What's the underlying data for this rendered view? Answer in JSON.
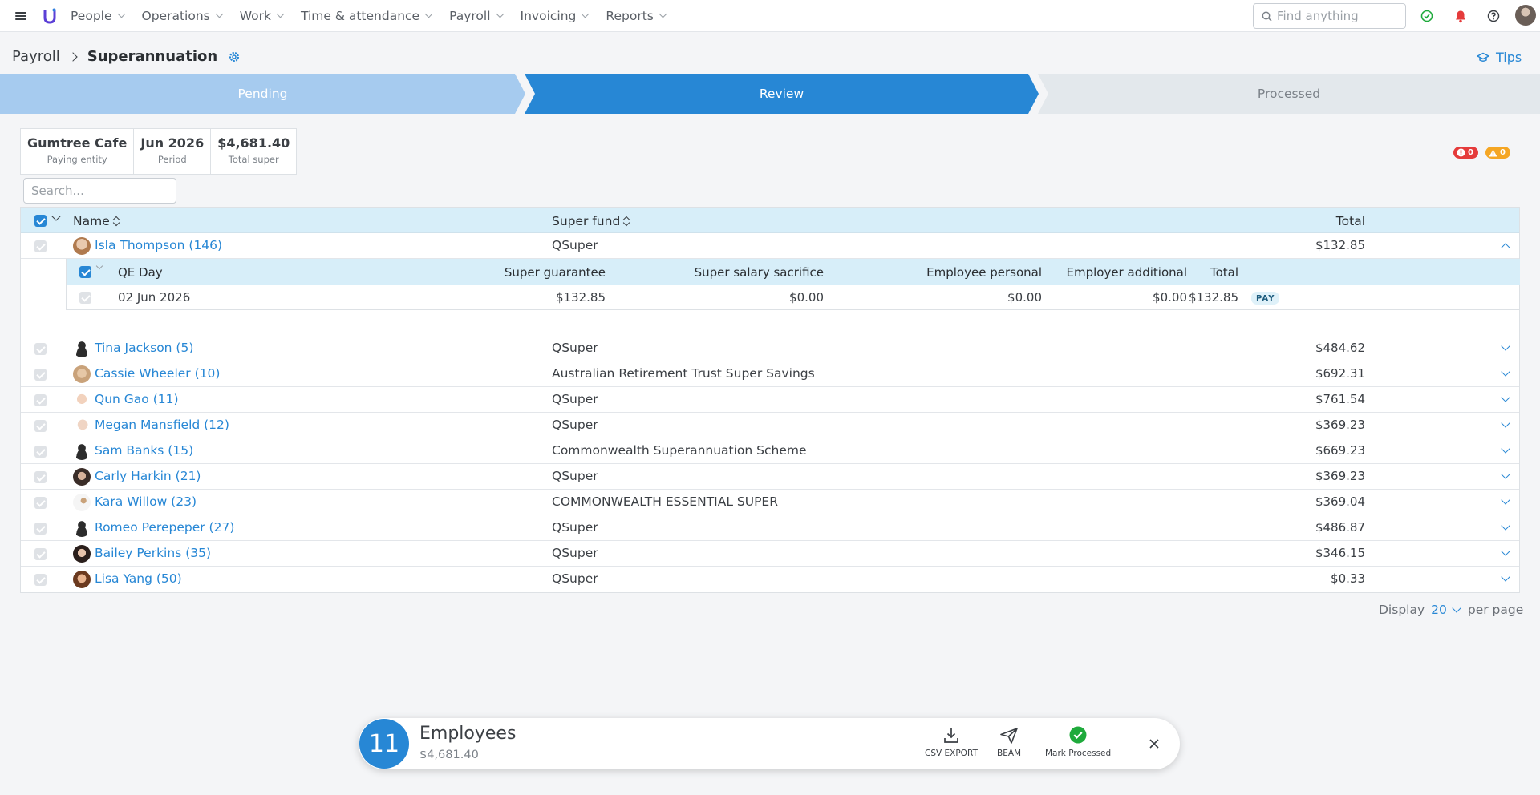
{
  "nav": {
    "items": [
      "People",
      "Operations",
      "Work",
      "Time & attendance",
      "Payroll",
      "Invoicing",
      "Reports"
    ],
    "search_placeholder": "Find anything"
  },
  "breadcrumb": {
    "parent": "Payroll",
    "current": "Superannuation"
  },
  "tips_label": "Tips",
  "stepper": {
    "steps": [
      "Pending",
      "Review",
      "Processed"
    ],
    "active": "Review"
  },
  "summary": [
    {
      "value": "Gumtree Cafe",
      "label": "Paying entity"
    },
    {
      "value": "Jun 2026",
      "label": "Period"
    },
    {
      "value": "$4,681.40",
      "label": "Total super"
    }
  ],
  "badges": {
    "errors": "0",
    "warnings": "0"
  },
  "table_search_placeholder": "Search...",
  "table": {
    "columns": {
      "name": "Name",
      "fund": "Super fund",
      "total": "Total"
    },
    "rows": [
      {
        "name": "Isla Thompson (146)",
        "fund": "QSuper",
        "total": "$132.85",
        "expanded": true
      },
      {
        "name": "Tina Jackson (5)",
        "fund": "QSuper",
        "total": "$484.62"
      },
      {
        "name": "Cassie Wheeler (10)",
        "fund": "Australian Retirement Trust Super Savings",
        "total": "$692.31"
      },
      {
        "name": "Qun Gao (11)",
        "fund": "QSuper",
        "total": "$761.54"
      },
      {
        "name": "Megan Mansfield (12)",
        "fund": "QSuper",
        "total": "$369.23"
      },
      {
        "name": "Sam Banks (15)",
        "fund": "Commonwealth Superannuation Scheme",
        "total": "$669.23"
      },
      {
        "name": "Carly Harkin (21)",
        "fund": "QSuper",
        "total": "$369.23"
      },
      {
        "name": "Kara Willow (23)",
        "fund": "COMMONWEALTH ESSENTIAL SUPER",
        "total": "$369.04"
      },
      {
        "name": "Romeo Perepeper (27)",
        "fund": "QSuper",
        "total": "$486.87"
      },
      {
        "name": "Bailey Perkins (35)",
        "fund": "QSuper",
        "total": "$346.15"
      },
      {
        "name": "Lisa Yang (50)",
        "fund": "QSuper",
        "total": "$0.33"
      }
    ]
  },
  "subtable": {
    "columns": [
      "QE Day",
      "Super guarantee",
      "Super salary sacrifice",
      "Employee personal",
      "Employer additional",
      "Total"
    ],
    "row": {
      "date": "02 Jun 2026",
      "sg": "$132.85",
      "ss": "$0.00",
      "ep": "$0.00",
      "ea": "$0.00",
      "total": "$132.85",
      "badge": "PAY"
    }
  },
  "pager": {
    "prefix": "Display",
    "value": "20",
    "suffix": "per page"
  },
  "bottombar": {
    "count": "11",
    "title": "Employees",
    "amount": "$4,681.40",
    "actions": [
      "CSV EXPORT",
      "BEAM",
      "Mark Processed"
    ]
  },
  "colors": {
    "accent": "#2787d5",
    "header_bg": "#d7eef9",
    "success": "#1faa3c",
    "danger": "#e53b3b",
    "warning": "#f5a623"
  }
}
